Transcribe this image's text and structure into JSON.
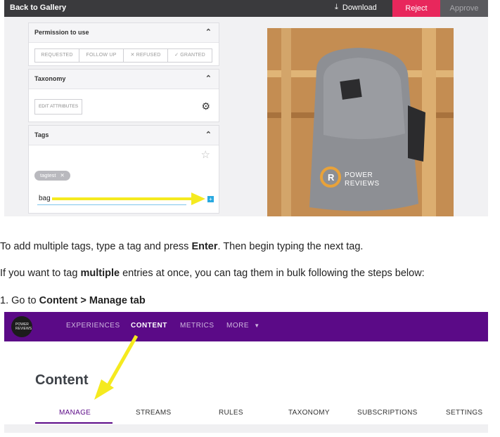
{
  "screenshot1": {
    "topbar": {
      "back_label": "Back to Gallery",
      "download_label": "Download",
      "reject_label": "Reject",
      "approve_label": "Approve",
      "colors": {
        "bar": "#3a3a3d",
        "reject": "#e8275c"
      }
    },
    "permission_panel": {
      "title": "Permission to use",
      "buttons": [
        "REQUESTED",
        "FOLLOW UP",
        "✕ REFUSED",
        "✓ GRANTED"
      ]
    },
    "taxonomy_panel": {
      "title": "Taxonomy",
      "edit_label": "EDIT ATTRIBUTES"
    },
    "tags_panel": {
      "title": "Tags",
      "chip": "tagtest",
      "input_value": "bag"
    },
    "photo": {
      "brand_line1": "POWER",
      "brand_line2": "REVIEWS"
    }
  },
  "instructions": {
    "p1_a": "To add multiple tags, type a tag and press ",
    "p1_b": "Enter",
    "p1_c": ". Then begin typing the next tag.",
    "p2_a": "If you want to tag ",
    "p2_b": "multiple",
    "p2_c": " entries at once, you can tag them in bulk following the steps below:",
    "p3_a": "1. Go to ",
    "p3_b": "Content > Manage tab"
  },
  "screenshot2": {
    "nav": [
      "EXPERIENCES",
      "CONTENT",
      "METRICS",
      "MORE"
    ],
    "logo_text": "POWER REVIEWS",
    "page_title": "Content",
    "tabs": [
      "MANAGE",
      "STREAMS",
      "RULES",
      "TAXONOMY",
      "SUBSCRIPTIONS",
      "SETTINGS"
    ],
    "colors": {
      "nav_bg": "#5b0a87",
      "arrow": "#f5ea1f"
    }
  }
}
